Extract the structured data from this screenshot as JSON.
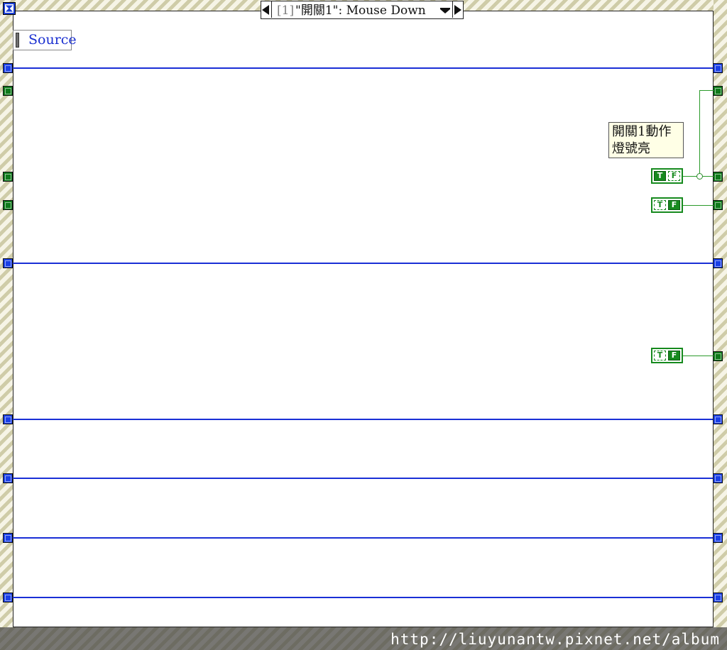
{
  "event_case": {
    "index": "[1]",
    "label": "\"開關1\": Mouse Down"
  },
  "event_data_node": {
    "item": "Source"
  },
  "comment": {
    "line1": "開關1動作",
    "line2": "燈號亮"
  },
  "constants": [
    {
      "name": "true-constant",
      "value": "T"
    },
    {
      "name": "false-constant-1",
      "value": "F"
    },
    {
      "name": "false-constant-2",
      "value": "F"
    }
  ],
  "watermark": "http://liuyunantw.pixnet.net/album",
  "colors": {
    "frame_hatch_dark": "#cfcca8",
    "frame_hatch_light": "#f6f4e6",
    "refnum_wire": "#1a2fd6",
    "boolean_wire": "#2a9a2a",
    "tunnel_blue": "#1a3fe6",
    "tunnel_green": "#0f7a1a",
    "index_gray": "#808080",
    "source_text": "#1a2fd0"
  }
}
